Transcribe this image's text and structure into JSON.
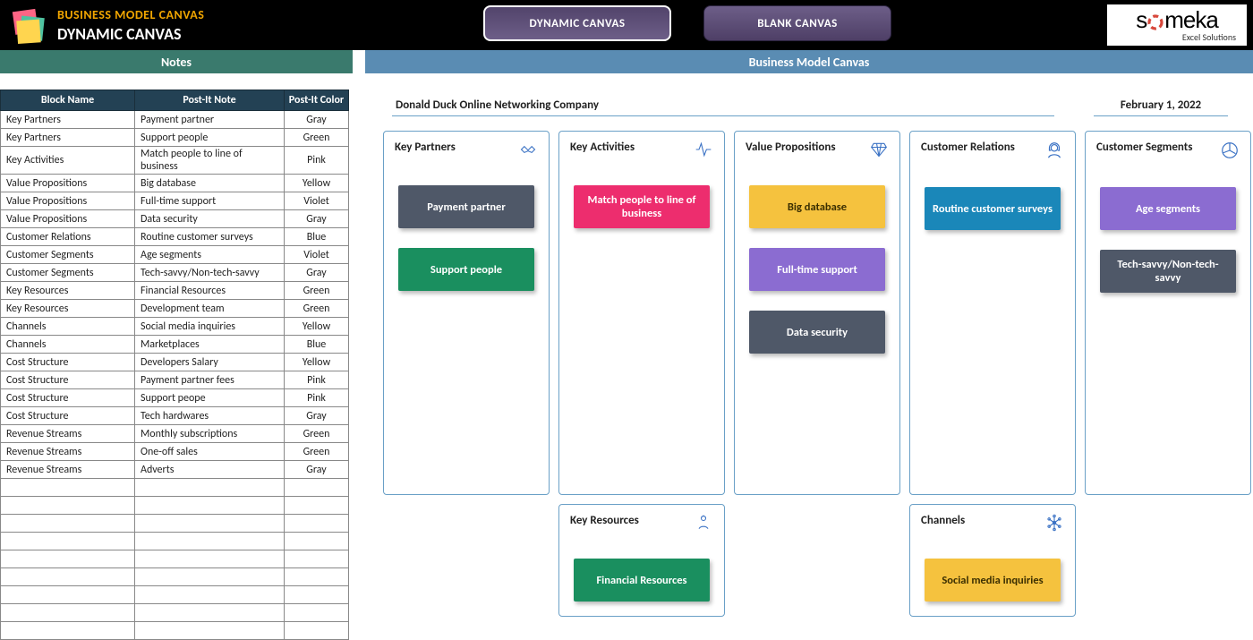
{
  "header": {
    "title": "BUSINESS MODEL CANVAS",
    "subtitle": "DYNAMIC CANVAS",
    "nav": {
      "dynamic": "DYNAMIC CANVAS",
      "blank": "BLANK CANVAS"
    },
    "brand": {
      "name": "someka",
      "tagline": "Excel Solutions"
    }
  },
  "second_bar": {
    "notes": "Notes",
    "canvas": "Business Model Canvas"
  },
  "notes_table": {
    "columns": {
      "block": "Block Name",
      "note": "Post-It Note",
      "color": "Post-It Color"
    },
    "rows": [
      {
        "block": "Key Partners",
        "note": "Payment partner",
        "color": "Gray"
      },
      {
        "block": "Key Partners",
        "note": "Support people",
        "color": "Green"
      },
      {
        "block": "Key Activities",
        "note": "Match people to line of business",
        "color": "Pink"
      },
      {
        "block": "Value Propositions",
        "note": "Big database",
        "color": "Yellow"
      },
      {
        "block": "Value Propositions",
        "note": "Full-time support",
        "color": "Violet"
      },
      {
        "block": "Value Propositions",
        "note": "Data security",
        "color": "Gray"
      },
      {
        "block": "Customer Relations",
        "note": "Routine customer surveys",
        "color": "Blue"
      },
      {
        "block": "Customer Segments",
        "note": "Age segments",
        "color": "Violet"
      },
      {
        "block": "Customer Segments",
        "note": "Tech-savvy/Non-tech-savvy",
        "color": "Gray"
      },
      {
        "block": "Key Resources",
        "note": "Financial Resources",
        "color": "Green"
      },
      {
        "block": "Key Resources",
        "note": "Development team",
        "color": "Green"
      },
      {
        "block": "Channels",
        "note": "Social media inquiries",
        "color": "Yellow"
      },
      {
        "block": "Channels",
        "note": "Marketplaces",
        "color": "Blue"
      },
      {
        "block": "Cost Structure",
        "note": "Developers Salary",
        "color": "Yellow"
      },
      {
        "block": "Cost Structure",
        "note": "Payment partner fees",
        "color": "Pink"
      },
      {
        "block": "Cost Structure",
        "note": "Support peope",
        "color": "Pink"
      },
      {
        "block": "Cost Structure",
        "note": "Tech hardwares",
        "color": "Gray"
      },
      {
        "block": "Revenue Streams",
        "note": "Monthly subscriptions",
        "color": "Green"
      },
      {
        "block": "Revenue Streams",
        "note": "One-off sales",
        "color": "Green"
      },
      {
        "block": "Revenue Streams",
        "note": "Adverts",
        "color": "Gray"
      }
    ],
    "blank_rows": 9
  },
  "canvas": {
    "company": "Donald Duck Online Networking Company",
    "date": "February 1, 2022",
    "blocks": {
      "key_partners": {
        "title": "Key Partners",
        "icon": "handshake-icon",
        "notes": [
          {
            "text": "Payment partner",
            "color": "Gray"
          },
          {
            "text": "Support people",
            "color": "Green"
          }
        ]
      },
      "key_activities": {
        "title": "Key Activities",
        "icon": "activity-icon",
        "notes": [
          {
            "text": "Match people to line of business",
            "color": "Pink"
          }
        ]
      },
      "key_resources": {
        "title": "Key Resources",
        "icon": "resources-icon",
        "notes": [
          {
            "text": "Financial Resources",
            "color": "Green"
          }
        ]
      },
      "value_propositions": {
        "title": "Value Propositions",
        "icon": "diamond-icon",
        "notes": [
          {
            "text": "Big database",
            "color": "Yellow"
          },
          {
            "text": "Full-time support",
            "color": "Violet"
          },
          {
            "text": "Data security",
            "color": "Gray"
          }
        ]
      },
      "customer_relations": {
        "title": "Customer Relations",
        "icon": "person-headset-icon",
        "notes": [
          {
            "text": "Routine customer surveys",
            "color": "Blue"
          }
        ]
      },
      "channels": {
        "title": "Channels",
        "icon": "network-icon",
        "notes": [
          {
            "text": "Social media inquiries",
            "color": "Yellow"
          }
        ]
      },
      "customer_segments": {
        "title": "Customer Segments",
        "icon": "segments-icon",
        "notes": [
          {
            "text": "Age segments",
            "color": "Violet"
          },
          {
            "text": "Tech-savvy/Non-tech-savvy",
            "color": "Gray"
          }
        ]
      }
    }
  }
}
